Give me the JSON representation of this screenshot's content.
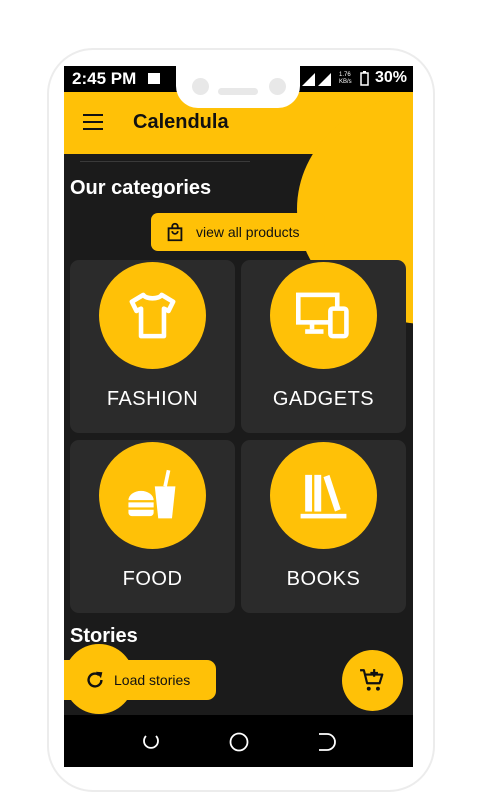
{
  "status_bar": {
    "time": "2:45 PM",
    "battery": "30%",
    "speed": "1.76 KB/s"
  },
  "app_bar": {
    "title": "Calendula"
  },
  "categories": {
    "heading": "Our categories",
    "view_all_label": "view all products",
    "items": [
      {
        "label": "FASHION",
        "icon": "tshirt-icon"
      },
      {
        "label": "GADGETS",
        "icon": "devices-icon"
      },
      {
        "label": "FOOD",
        "icon": "fastfood-icon"
      },
      {
        "label": "BOOKS",
        "icon": "books-icon"
      }
    ]
  },
  "stories": {
    "heading": "Stories",
    "load_label": "Load stories"
  },
  "colors": {
    "accent": "#ffc107",
    "background": "#1b1b1b",
    "card": "#2b2b2b"
  }
}
